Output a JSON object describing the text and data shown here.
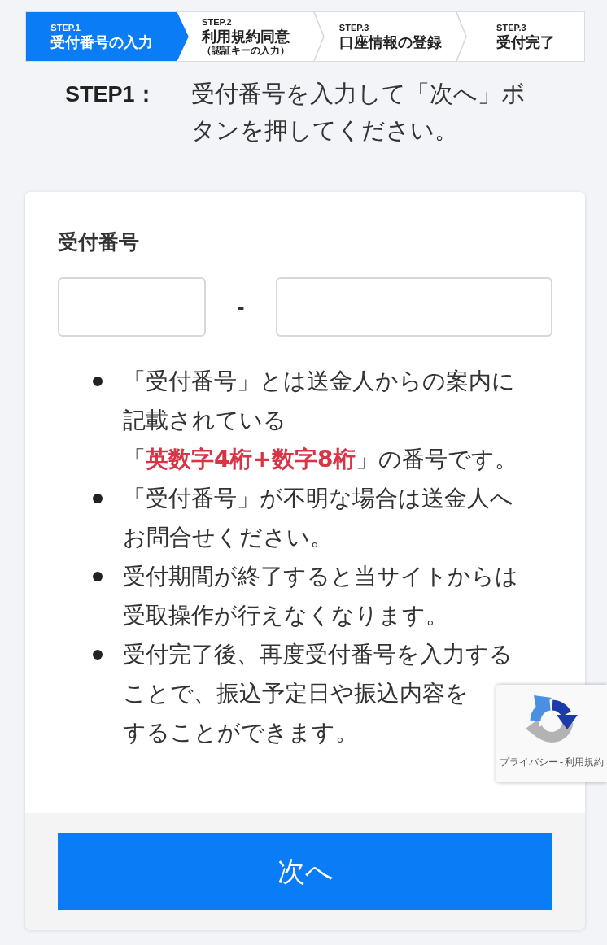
{
  "steps": [
    {
      "number": "STEP.1",
      "title": "受付番号の入力",
      "selected": true
    },
    {
      "number": "STEP.2",
      "title": "利用規約同意",
      "subtitle": "（認証キーの入力）",
      "selected": false
    },
    {
      "number": "STEP.3",
      "title": "口座情報の登録",
      "selected": false
    },
    {
      "number": "STEP.3",
      "title": "受付完了",
      "selected": false
    }
  ],
  "instruction": {
    "label": "STEP1：",
    "text": "受付番号を入力して「次へ」ボタンを押してください。"
  },
  "form": {
    "label": "受付番号",
    "separator": "-",
    "notes": [
      {
        "text": "「受付番号」とは送金人からの案内に記載されている「**英数字4桁+数字8桁**」の番号です。"
      },
      {
        "text": "「受付番号」が不明な場合は送金人へお問合せください。"
      },
      {
        "text": "受付期間が終了すると当サイトからは受取操作が行えなくなります。"
      },
      {
        "text": "受付完了後、再度受付番号を入力することで、振込予定日や振込内容を",
        "continued_text": "することができます。"
      }
    ],
    "next_button": "次へ"
  },
  "captcha_badge": {
    "privacy_link": "プライバシー",
    "separator": "-",
    "terms_link": "利用規約"
  }
}
